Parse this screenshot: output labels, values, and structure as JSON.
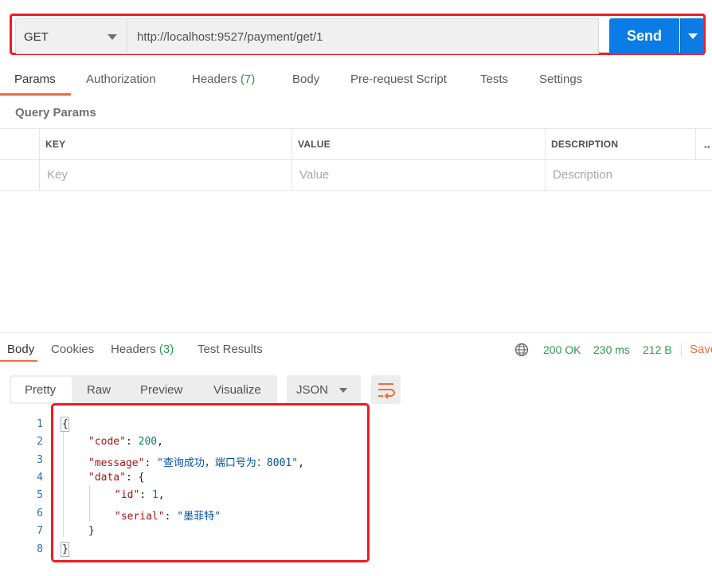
{
  "request": {
    "method": "GET",
    "url": "http://localhost:9527/payment/get/1",
    "send_label": "Send"
  },
  "tabs": [
    {
      "label": "Params"
    },
    {
      "label": "Authorization"
    },
    {
      "label": "Headers",
      "count": "(7)"
    },
    {
      "label": "Body"
    },
    {
      "label": "Pre-request Script"
    },
    {
      "label": "Tests"
    },
    {
      "label": "Settings"
    }
  ],
  "query_params": {
    "title": "Query Params",
    "headers": [
      "KEY",
      "VALUE",
      "DESCRIPTION"
    ],
    "placeholders": [
      "Key",
      "Value",
      "Description"
    ],
    "more": "••"
  },
  "response": {
    "tabs": [
      {
        "label": "Body"
      },
      {
        "label": "Cookies"
      },
      {
        "label": "Headers",
        "count": "(3)"
      },
      {
        "label": "Test Results"
      }
    ],
    "status": "200 OK",
    "time": "230 ms",
    "size": "212 B",
    "save_label": "Save"
  },
  "view": {
    "modes": [
      "Pretty",
      "Raw",
      "Preview",
      "Visualize"
    ],
    "format": "JSON"
  },
  "body_lines": [
    {
      "n": "1",
      "text": "{"
    },
    {
      "n": "2",
      "key": "\"code\"",
      "val": "200",
      "type": "num",
      "suffix": ","
    },
    {
      "n": "3",
      "key": "\"message\"",
      "val": "\"查询成功，端口号为：8001\"",
      "type": "str",
      "suffix": ","
    },
    {
      "n": "4",
      "key": "\"data\"",
      "val": "{",
      "type": "punc",
      "suffix": ""
    },
    {
      "n": "5",
      "key": "\"id\"",
      "val": "1",
      "type": "num",
      "suffix": ","
    },
    {
      "n": "6",
      "key": "\"serial\"",
      "val": "\"墨菲特\"",
      "type": "str",
      "suffix": ""
    },
    {
      "n": "7",
      "text": "}"
    },
    {
      "n": "8",
      "text": "}"
    }
  ],
  "colors": {
    "accent": "#f26b3a",
    "send": "#0b7ce5",
    "highlight_box": "#ee1c25",
    "status_green": "#2b9a46"
  }
}
